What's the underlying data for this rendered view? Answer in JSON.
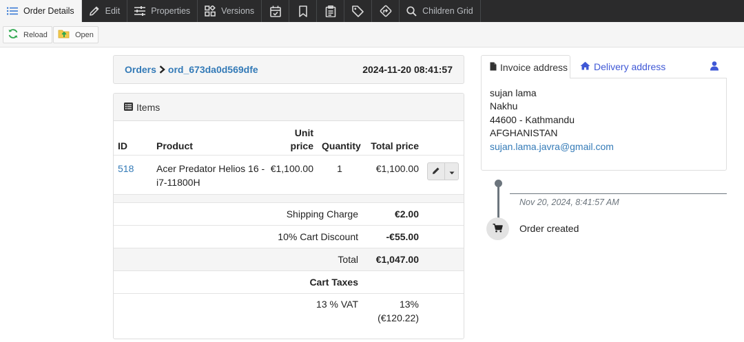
{
  "tabs": [
    {
      "label": "Order Details",
      "icon": "list-icon",
      "active": true
    },
    {
      "label": "Edit",
      "icon": "pencil-icon"
    },
    {
      "label": "Properties",
      "icon": "sliders-icon"
    },
    {
      "label": "Versions",
      "icon": "versions-icon"
    },
    {
      "label": "",
      "icon": "calendar-check-icon"
    },
    {
      "label": "",
      "icon": "bookmark-icon"
    },
    {
      "label": "",
      "icon": "clipboard-icon"
    },
    {
      "label": "",
      "icon": "tag-icon"
    },
    {
      "label": "",
      "icon": "direction-sign-icon"
    },
    {
      "label": "Children Grid",
      "icon": "search-icon"
    }
  ],
  "toolbar": {
    "reload_label": "Reload",
    "open_label": "Open"
  },
  "breadcrumb": {
    "root": "Orders",
    "current": "ord_673da0d569dfe",
    "date": "2024-11-20 08:41:57"
  },
  "items": {
    "title": "Items",
    "headers": {
      "id": "ID",
      "product": "Product",
      "unit_price_line1": "Unit",
      "unit_price_line2": "price",
      "quantity": "Quantity",
      "total_price": "Total price"
    },
    "rows": [
      {
        "id": "518",
        "product_line1": "Acer Predator Helios 16 -",
        "product_line2": "i7-11800H",
        "unit_price": "€1,100.00",
        "quantity": "1",
        "total_price": "€1,100.00"
      }
    ],
    "summary": {
      "shipping_label": "Shipping Charge",
      "shipping_value": "€2.00",
      "discount_label": "10% Cart Discount",
      "discount_value": "-€55.00",
      "total_label": "Total",
      "total_value": "€1,047.00",
      "taxes_label": "Cart Taxes",
      "vat_label": "13 % VAT",
      "vat_rate": "13%",
      "vat_amount": "(€120.22)"
    }
  },
  "address": {
    "invoice_tab": "Invoice address",
    "delivery_tab": "Delivery address",
    "lines": [
      "sujan lama",
      "Nakhu",
      "44600 - Kathmandu",
      "AFGHANISTAN"
    ],
    "email": "sujan.lama.javra@gmail.com"
  },
  "timeline": {
    "date": "Nov 20, 2024, 8:41:57 AM",
    "event": "Order created"
  },
  "colors": {
    "link": "#337ab7",
    "delivery_tab": "#3f58d6",
    "tabbar": "#2b2b2c",
    "timeline": "#6c757d"
  }
}
